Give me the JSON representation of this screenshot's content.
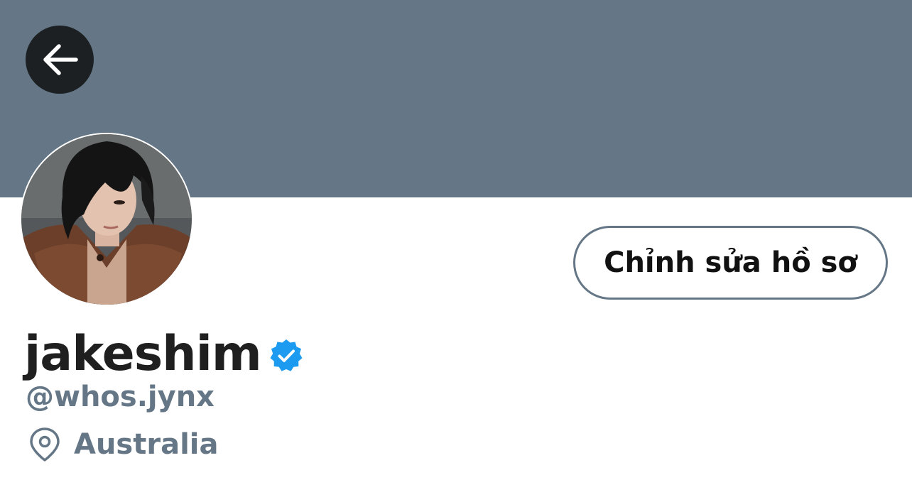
{
  "profile": {
    "edit_button_label": "Chỉnh sửa hồ sơ",
    "display_name": "jakeshim",
    "handle": "@whos.jynx",
    "location": "Australia",
    "verified": true
  },
  "icons": {
    "back": "arrow-left-icon",
    "verified": "verified-badge-icon",
    "location": "location-pin-icon"
  },
  "colors": {
    "banner": "#657786",
    "back_button_bg": "#1c2023",
    "verified_blue": "#1d9bf0",
    "secondary_text": "#657786",
    "primary_text": "#1f1f1f"
  }
}
